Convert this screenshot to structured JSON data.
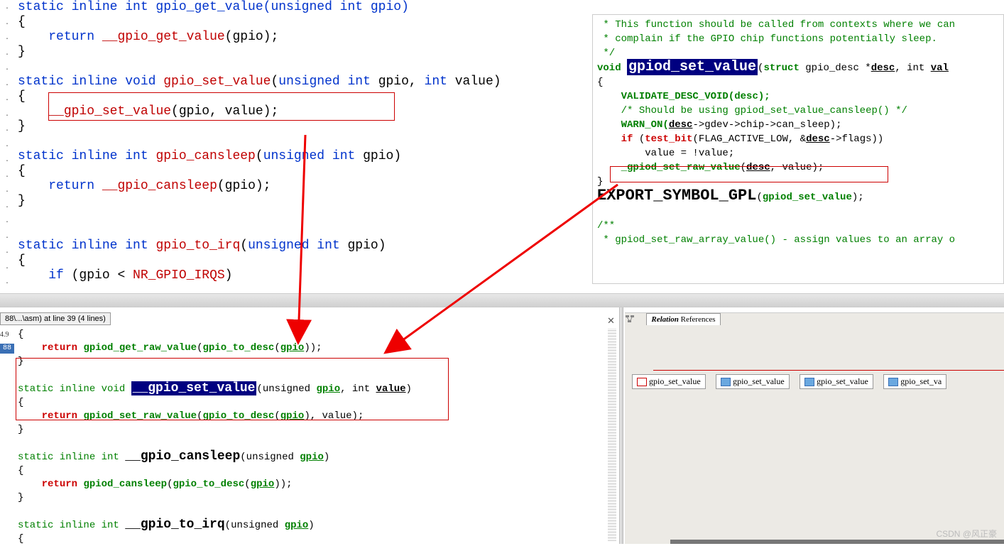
{
  "gutter_dots": ". . . . . . . . . . . . . . . . . . .",
  "top_left_code": {
    "l1": "static inline int gpio_get_value(unsigned int gpio)",
    "l2": "{",
    "l3_a": "return",
    "l3_b": "__gpio_get_value",
    "l3_c": "(gpio);",
    "l4": "}",
    "l5a": "static inline void ",
    "l5b": "gpio_set_value",
    "l5c": "(",
    "l5d": "unsigned int",
    "l5e": " gpio, ",
    "l5f": "int",
    "l5g": " value)",
    "l6": "{",
    "l7a": "__gpio_set_value",
    "l7b": "(gpio, value);",
    "l8": "}",
    "l9a": "static inline int ",
    "l9b": "gpio_cansleep",
    "l9c": "(",
    "l9d": "unsigned int",
    "l9e": " gpio)",
    "l10": "{",
    "l11a": "return",
    "l11b": "__gpio_cansleep",
    "l11c": "(gpio);",
    "l12": "}",
    "l13a": "static inline int ",
    "l13b": "gpio_to_irq",
    "l13c": "(",
    "l13d": "unsigned int",
    "l13e": " gpio)",
    "l14": "{",
    "l15a": "if",
    "l15b": " (gpio < ",
    "l15c": "NR_GPIO_IRQS",
    "l15d": ")"
  },
  "top_right_code": {
    "c1": " * This function should be called from contexts where we can",
    "c2": " * complain if the GPIO chip functions potentially sleep.",
    "c3": " */",
    "v1": "void ",
    "hl": "gpiod_set_value",
    "v2": "(",
    "v3": "struct",
    "v4": " gpio_desc *",
    "v5": "desc",
    "v6": ", int ",
    "v7": "val",
    "b1": "{",
    "b2": "VALIDATE_DESC_VOID(desc);",
    "b3": "/* Should be using gpiod_set_value_cansleep() */",
    "b4a": "WARN_ON(",
    "b4b": "desc",
    "b4c": "->gdev->chip->can_sleep);",
    "b5a": "if ",
    "b5b": "(",
    "b5c": "test_bit",
    "b5d": "(FLAG_ACTIVE_LOW, &",
    "b5e": "desc",
    "b5f": "->flags))",
    "b6": "value = !value;",
    "b7a": "_gpiod_set_raw_value",
    "b7b": "(",
    "b7c": "desc",
    "b7d": ", value);",
    "b8": "}",
    "ex1": "EXPORT_SYMBOL_GPL",
    "ex2": "(",
    "ex3": "gpiod_set_value",
    "ex4": ");",
    "c4": "/**",
    "c5": " * gpiod_set_raw_array_value() - assign values to an array o"
  },
  "tab_label": "88\\...\\asm) at line 39 (4 lines)",
  "num49": "4.9",
  "num88": "88",
  "bottom_left_code": {
    "l0": "{",
    "l1a": "return",
    "l1b": "gpiod_get_raw_value",
    "l1c": "(",
    "l1d": "gpio_to_desc",
    "l1e": "(",
    "l1f": "gpio",
    "l1g": "));",
    "l2": "}",
    "l3a": "static inline void ",
    "hl": "__gpio_set_value",
    "l3b": "(unsigned ",
    "l3c": "gpio",
    "l3d": ", int ",
    "l3e": "value",
    "l3f": ")",
    "l4": "{",
    "l5a": "return",
    "l5b": "gpiod_set_raw_value",
    "l5c": "(",
    "l5d": "gpio_to_desc",
    "l5e": "(",
    "l5f": "gpio",
    "l5g": "), value);",
    "l6": "}",
    "l7a": "static inline int ",
    "l7b": "__gpio_cansleep",
    "l7c": "(unsigned ",
    "l7d": "gpio",
    "l7e": ")",
    "l8": "{",
    "l9a": "return",
    "l9b": "gpiod_cansleep",
    "l9c": "(",
    "l9d": "gpio_to_desc",
    "l9e": "(",
    "l9f": "gpio",
    "l9g": "));",
    "l10": "}",
    "l11a": "static inline int ",
    "l11b": "__gpio_to_irq",
    "l11c": "(unsigned ",
    "l11d": "gpio",
    "l11e": ")",
    "l12": "{"
  },
  "relation": {
    "title_bold": "Relation",
    "title_rest": " References",
    "refs": [
      "gpio_set_value",
      "gpio_set_value",
      "gpio_set_value",
      "gpio_set_va"
    ]
  },
  "watermark": "CSDN @风正豪",
  "close_x": "✕"
}
